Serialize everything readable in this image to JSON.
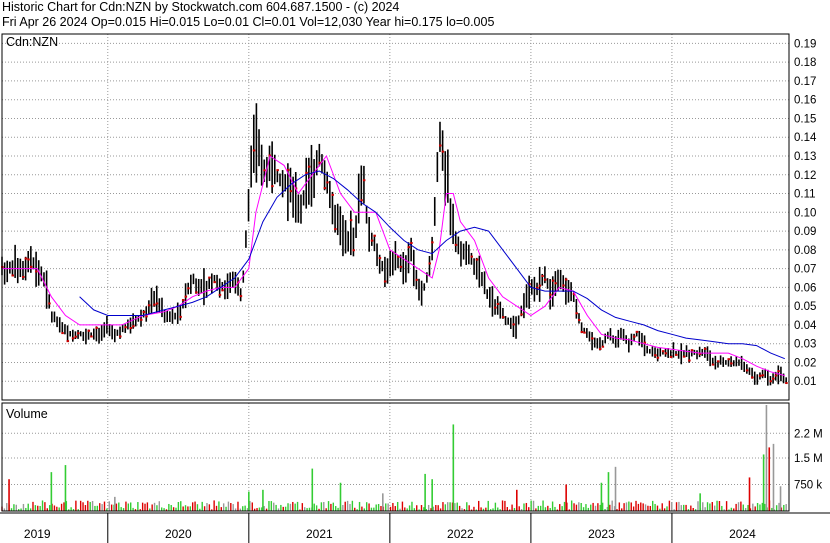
{
  "header": {
    "line1": "Historic Chart for Cdn:NZN by Stockwatch.com 604.687.1500 - (c) 2024",
    "line2": "Fri Apr 26 2024   Op=0.015   Hi=0.015   Lo=0.01   Cl=0.01   Vol=12,030   Year hi=0.175   lo=0.005"
  },
  "colors": {
    "price_bar": "#000000",
    "ma_short": "#ff00ff",
    "ma_long": "#0000cc",
    "close_mark": "#cc0000",
    "vol_up": "#33cc33",
    "vol_down": "#dd0000",
    "vol_neutral": "#999999",
    "grid": "#999999"
  },
  "chart_data": {
    "type": "line",
    "price_panel": {
      "label": "Cdn:NZN",
      "y_ticks": [
        0.01,
        0.02,
        0.03,
        0.04,
        0.05,
        0.06,
        0.07,
        0.08,
        0.09,
        0.1,
        0.11,
        0.12,
        0.13,
        0.14,
        0.15,
        0.16,
        0.17,
        0.18,
        0.19
      ],
      "ylim": [
        0.0,
        0.195
      ],
      "x_range": [
        2018.75,
        2024.33
      ],
      "grid": true,
      "series": [
        {
          "style": "price",
          "x": [
            2018.75,
            2018.85,
            2018.92,
            2018.95,
            2019.0,
            2019.05,
            2019.1,
            2019.15,
            2019.25,
            2019.35,
            2019.45,
            2019.5,
            2019.55,
            2019.65,
            2019.75,
            2019.85,
            2019.9,
            2019.95,
            2020.0,
            2020.05,
            2020.1,
            2020.15,
            2020.2,
            2020.25,
            2020.3,
            2020.35,
            2020.4,
            2020.45,
            2020.5,
            2020.55,
            2020.6,
            2020.65,
            2020.7,
            2020.75,
            2020.8,
            2020.85,
            2020.9,
            2020.95,
            2021.0,
            2021.05,
            2021.1,
            2021.15,
            2021.2,
            2021.25,
            2021.3,
            2021.35,
            2021.4,
            2021.45,
            2021.5,
            2021.55,
            2021.6,
            2021.65,
            2021.7,
            2021.75,
            2021.8,
            2021.85,
            2021.9,
            2021.95,
            2022.0,
            2022.05,
            2022.1,
            2022.15,
            2022.2,
            2022.25,
            2022.3,
            2022.35,
            2022.4,
            2022.45,
            2022.5,
            2022.55,
            2022.6,
            2022.65,
            2022.7,
            2022.75,
            2022.8,
            2022.85,
            2022.9,
            2022.95,
            2023.0,
            2023.05,
            2023.1,
            2023.15,
            2023.2,
            2023.25,
            2023.3,
            2023.35,
            2023.4,
            2023.45,
            2023.5,
            2023.55,
            2023.6,
            2023.65,
            2023.7,
            2023.75,
            2023.8,
            2023.85,
            2023.9,
            2023.95,
            2024.0,
            2024.05,
            2024.1,
            2024.15,
            2024.2,
            2024.25,
            2024.3
          ],
          "y": [
            0.07,
            0.07,
            0.07,
            0.075,
            0.07,
            0.065,
            0.045,
            0.04,
            0.035,
            0.035,
            0.035,
            0.04,
            0.035,
            0.04,
            0.045,
            0.055,
            0.045,
            0.045,
            0.045,
            0.055,
            0.065,
            0.06,
            0.06,
            0.065,
            0.06,
            0.06,
            0.065,
            0.055,
            0.11,
            0.14,
            0.12,
            0.13,
            0.12,
            0.115,
            0.11,
            0.1,
            0.11,
            0.12,
            0.13,
            0.12,
            0.1,
            0.09,
            0.085,
            0.085,
            0.12,
            0.09,
            0.08,
            0.07,
            0.07,
            0.075,
            0.07,
            0.08,
            0.06,
            0.06,
            0.08,
            0.14,
            0.12,
            0.09,
            0.08,
            0.08,
            0.07,
            0.065,
            0.055,
            0.05,
            0.045,
            0.04,
            0.04,
            0.05,
            0.06,
            0.06,
            0.065,
            0.055,
            0.065,
            0.06,
            0.055,
            0.04,
            0.035,
            0.03,
            0.03,
            0.035,
            0.03,
            0.035,
            0.03,
            0.035,
            0.03,
            0.025,
            0.025,
            0.025,
            0.025,
            0.025,
            0.025,
            0.025,
            0.025,
            0.025,
            0.02,
            0.02,
            0.02,
            0.02,
            0.02,
            0.015,
            0.01,
            0.015,
            0.01,
            0.015,
            0.01
          ]
        },
        {
          "style": "ma_short",
          "x": [
            2018.75,
            2018.9,
            2019.0,
            2019.1,
            2019.2,
            2019.3,
            2019.45,
            2019.6,
            2019.75,
            2019.9,
            2020.0,
            2020.1,
            2020.2,
            2020.3,
            2020.4,
            2020.5,
            2020.55,
            2020.65,
            2020.75,
            2020.85,
            2020.95,
            2021.05,
            2021.15,
            2021.25,
            2021.3,
            2021.4,
            2021.5,
            2021.6,
            2021.7,
            2021.8,
            2021.85,
            2021.9,
            2021.95,
            2022.0,
            2022.1,
            2022.2,
            2022.3,
            2022.4,
            2022.5,
            2022.6,
            2022.7,
            2022.8,
            2022.9,
            2023.0,
            2023.1,
            2023.2,
            2023.3,
            2023.4,
            2023.5,
            2023.6,
            2023.7,
            2023.8,
            2023.9,
            2024.0,
            2024.1,
            2024.2,
            2024.3
          ],
          "y": [
            0.07,
            0.07,
            0.07,
            0.055,
            0.045,
            0.04,
            0.04,
            0.04,
            0.045,
            0.047,
            0.05,
            0.055,
            0.058,
            0.06,
            0.06,
            0.07,
            0.1,
            0.13,
            0.125,
            0.11,
            0.12,
            0.13,
            0.11,
            0.1,
            0.1,
            0.1,
            0.08,
            0.075,
            0.07,
            0.065,
            0.08,
            0.11,
            0.11,
            0.095,
            0.085,
            0.065,
            0.055,
            0.05,
            0.045,
            0.05,
            0.06,
            0.058,
            0.045,
            0.035,
            0.033,
            0.032,
            0.03,
            0.028,
            0.027,
            0.026,
            0.025,
            0.025,
            0.025,
            0.022,
            0.018,
            0.015,
            0.013
          ]
        },
        {
          "style": "ma_long",
          "x": [
            2019.3,
            2019.4,
            2019.5,
            2019.6,
            2019.75,
            2019.9,
            2020.0,
            2020.1,
            2020.2,
            2020.3,
            2020.4,
            2020.5,
            2020.6,
            2020.7,
            2020.8,
            2020.9,
            2021.0,
            2021.1,
            2021.2,
            2021.3,
            2021.4,
            2021.5,
            2021.6,
            2021.7,
            2021.8,
            2021.9,
            2022.0,
            2022.1,
            2022.2,
            2022.3,
            2022.4,
            2022.5,
            2022.6,
            2022.7,
            2022.8,
            2022.9,
            2023.0,
            2023.1,
            2023.2,
            2023.3,
            2023.4,
            2023.5,
            2023.6,
            2023.7,
            2023.8,
            2023.9,
            2024.0,
            2024.1,
            2024.2,
            2024.3
          ],
          "y": [
            0.055,
            0.048,
            0.045,
            0.045,
            0.045,
            0.048,
            0.05,
            0.052,
            0.055,
            0.06,
            0.065,
            0.075,
            0.095,
            0.108,
            0.115,
            0.12,
            0.122,
            0.118,
            0.112,
            0.105,
            0.1,
            0.092,
            0.085,
            0.08,
            0.078,
            0.085,
            0.09,
            0.092,
            0.09,
            0.08,
            0.07,
            0.06,
            0.058,
            0.058,
            0.058,
            0.054,
            0.048,
            0.044,
            0.042,
            0.04,
            0.037,
            0.035,
            0.033,
            0.032,
            0.031,
            0.03,
            0.03,
            0.029,
            0.025,
            0.022
          ]
        }
      ]
    },
    "volume_panel": {
      "label": "Volume",
      "y_ticks": [
        "750 k",
        "1.5 M",
        "2.2 M"
      ],
      "tick_values": [
        750000,
        1500000,
        2200000
      ],
      "ylim": [
        0,
        3000000
      ],
      "spikes": [
        {
          "x": 2018.8,
          "v": 900000,
          "dir": "down"
        },
        {
          "x": 2019.1,
          "v": 1100000,
          "dir": "up"
        },
        {
          "x": 2019.2,
          "v": 1300000,
          "dir": "up"
        },
        {
          "x": 2019.55,
          "v": 400000,
          "dir": "neutral"
        },
        {
          "x": 2020.5,
          "v": 550000,
          "dir": "up"
        },
        {
          "x": 2020.6,
          "v": 600000,
          "dir": "up"
        },
        {
          "x": 2020.95,
          "v": 1200000,
          "dir": "up"
        },
        {
          "x": 2021.15,
          "v": 800000,
          "dir": "up"
        },
        {
          "x": 2021.45,
          "v": 500000,
          "dir": "neutral"
        },
        {
          "x": 2021.75,
          "v": 1050000,
          "dir": "up"
        },
        {
          "x": 2021.8,
          "v": 900000,
          "dir": "up"
        },
        {
          "x": 2021.95,
          "v": 2450000,
          "dir": "up"
        },
        {
          "x": 2022.4,
          "v": 600000,
          "dir": "down"
        },
        {
          "x": 2022.75,
          "v": 750000,
          "dir": "down"
        },
        {
          "x": 2023.0,
          "v": 800000,
          "dir": "up"
        },
        {
          "x": 2023.05,
          "v": 1100000,
          "dir": "up"
        },
        {
          "x": 2023.1,
          "v": 1250000,
          "dir": "neutral"
        },
        {
          "x": 2023.7,
          "v": 500000,
          "dir": "up"
        },
        {
          "x": 2024.05,
          "v": 950000,
          "dir": "down"
        },
        {
          "x": 2024.15,
          "v": 1600000,
          "dir": "up"
        },
        {
          "x": 2024.17,
          "v": 3000000,
          "dir": "neutral"
        },
        {
          "x": 2024.19,
          "v": 1800000,
          "dir": "down"
        },
        {
          "x": 2024.22,
          "v": 1900000,
          "dir": "neutral"
        },
        {
          "x": 2024.27,
          "v": 700000,
          "dir": "neutral"
        }
      ]
    },
    "x_axis": {
      "labels": [
        "2019",
        "2020",
        "2021",
        "2022",
        "2023",
        "2024"
      ],
      "label_positions": [
        2019.0,
        2020.0,
        2021.0,
        2022.0,
        2023.0,
        2024.0
      ],
      "year_boundaries": [
        2019.5,
        2020.5,
        2021.5,
        2022.5,
        2023.5
      ]
    }
  }
}
